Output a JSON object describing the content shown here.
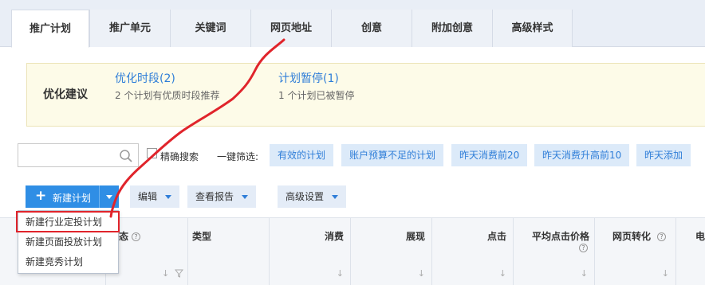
{
  "tabs": [
    "推广计划",
    "推广单元",
    "关键词",
    "网页地址",
    "创意",
    "附加创意",
    "高级样式"
  ],
  "suggestions": {
    "title": "优化建议",
    "items": [
      {
        "link": "优化时段(2)",
        "desc": "2 个计划有优质时段推荐"
      },
      {
        "link": "计划暂停(1)",
        "desc": "1 个计划已被暂停"
      }
    ]
  },
  "filter": {
    "search_placeholder": "",
    "exact_label": "精确搜索",
    "quick_label": "一键筛选:",
    "chips": [
      "有效的计划",
      "账户预算不足的计划",
      "昨天消费前20",
      "昨天消费升高前10",
      "昨天添加"
    ]
  },
  "toolbar": {
    "new_plan": "新建计划",
    "edit": "编辑",
    "report": "查看报告",
    "advanced": "高级设置"
  },
  "menu": [
    "新建行业定投计划",
    "新建页面投放计划",
    "新建竞秀计划"
  ],
  "table_headers": [
    "态",
    "类型",
    "消费",
    "展现",
    "点击",
    "平均点击价格",
    "网页转化",
    "电"
  ],
  "colors": {
    "accent": "#2f8ee5",
    "link": "#2f7ed8",
    "annotation": "#e0242b",
    "suggest_bg": "#fdfbe8"
  }
}
